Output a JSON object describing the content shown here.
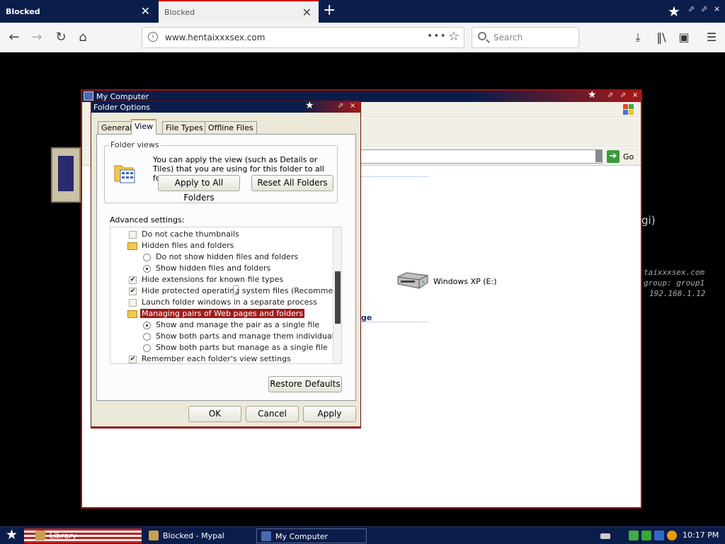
{
  "browser": {
    "tabs": [
      {
        "label": "Blocked",
        "active": false
      },
      {
        "label": "Blocked",
        "active": true
      }
    ],
    "url": "www.hentaixxxsex.com",
    "search_placeholder": "Search",
    "url_more": "•••"
  },
  "page_background": {
    "cgi_text": "gi)",
    "terminal_lines": [
      "taixxxsex.com",
      "group: group1",
      "192.168.1.12"
    ]
  },
  "my_computer": {
    "title": "My Computer",
    "go_label": "Go",
    "drive_label": "Windows XP (E:)",
    "fragment_text": "ge"
  },
  "folder_options": {
    "title": "Folder Options",
    "tabs": [
      "General",
      "View",
      "File Types",
      "Offline Files"
    ],
    "active_tab": "View",
    "folder_views": {
      "legend": "Folder views",
      "description": "You can apply the view (such as Details or Tiles) that you are using for this folder to all folders.",
      "apply_button": "Apply to All Folders",
      "reset_button": "Reset All Folders"
    },
    "advanced_label": "Advanced settings:",
    "advanced_items": [
      {
        "label": "Do not cache thumbnails",
        "type": "checkbox",
        "checked": false
      },
      {
        "label": "Hidden files and folders",
        "type": "folder"
      },
      {
        "label": "Do not show hidden files and folders",
        "type": "radio",
        "checked": false
      },
      {
        "label": "Show hidden files and folders",
        "type": "radio",
        "checked": true
      },
      {
        "label": "Hide extensions for known file types",
        "type": "checkbox",
        "checked": true
      },
      {
        "label": "Hide protected operating system files (Recommended)",
        "type": "checkbox",
        "checked": true
      },
      {
        "label": "Launch folder windows in a separate process",
        "type": "checkbox",
        "checked": false
      },
      {
        "label": "Managing pairs of Web pages and folders",
        "type": "folder",
        "selected": true
      },
      {
        "label": "Show and manage the pair as a single file",
        "type": "radio",
        "checked": true
      },
      {
        "label": "Show both parts and manage them individually",
        "type": "radio",
        "checked": false
      },
      {
        "label": "Show both parts but manage as a single file",
        "type": "radio",
        "checked": false
      },
      {
        "label": "Remember each folder's view settings",
        "type": "checkbox",
        "checked": true
      }
    ],
    "restore_button": "Restore Defaults",
    "ok_button": "OK",
    "cancel_button": "Cancel",
    "apply_button": "Apply"
  },
  "taskbar": {
    "items": [
      {
        "label": "Library"
      },
      {
        "label": "Blocked - Mypal"
      },
      {
        "label": "My Computer"
      }
    ],
    "clock": "10:17 PM"
  },
  "icons": {
    "back": "arrow-left-icon",
    "forward": "arrow-right-icon",
    "reload": "reload-icon",
    "home": "home-icon",
    "download": "download-icon",
    "library": "library-icon",
    "sidebar": "sidebar-icon",
    "menu": "hamburger-menu-icon"
  },
  "colors": {
    "titlebar_blue": "#0b1d4a",
    "accent_red": "#a51919",
    "dialog_face": "#ece9d8",
    "selection": "#a11a1a"
  }
}
